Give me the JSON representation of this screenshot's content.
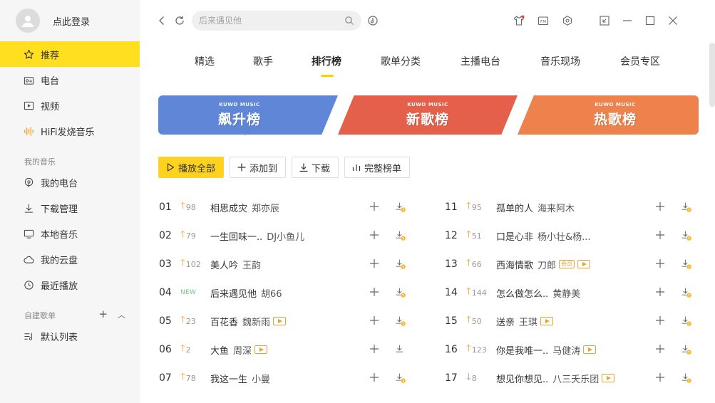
{
  "user": {
    "login_label": "点此登录"
  },
  "sidebar": {
    "nav": [
      {
        "label": "推荐",
        "icon": "star-icon"
      },
      {
        "label": "电台",
        "icon": "radio-icon"
      },
      {
        "label": "视频",
        "icon": "video-icon"
      },
      {
        "label": "HiFi发烧音乐",
        "icon": "hifi-icon"
      }
    ],
    "my_music_label": "我的音乐",
    "my_music": [
      {
        "label": "我的电台",
        "icon": "podcast-icon"
      },
      {
        "label": "下载管理",
        "icon": "download-icon"
      },
      {
        "label": "本地音乐",
        "icon": "monitor-icon"
      },
      {
        "label": "我的云盘",
        "icon": "cloud-icon"
      },
      {
        "label": "最近播放",
        "icon": "clock-icon"
      }
    ],
    "playlist_label": "自建歌单",
    "playlists": [
      {
        "label": "默认列表",
        "icon": "playlist-icon"
      }
    ]
  },
  "search": {
    "placeholder": "后来遇见他"
  },
  "tabs": [
    {
      "label": "精选"
    },
    {
      "label": "歌手"
    },
    {
      "label": "排行榜"
    },
    {
      "label": "歌单分类"
    },
    {
      "label": "主播电台"
    },
    {
      "label": "音乐现场"
    },
    {
      "label": "会员专区"
    }
  ],
  "active_tab": 2,
  "banners": [
    {
      "brand": "KUWO MUSIC",
      "title": "飙升榜",
      "color": "#5f86d7"
    },
    {
      "brand": "KUWO MUSIC",
      "title": "新歌榜",
      "color": "#e4604b"
    },
    {
      "brand": "KUWO MUSIC",
      "title": "热歌榜",
      "color": "#ee824d"
    }
  ],
  "actions": {
    "play_all": "播放全部",
    "add_to": "添加到",
    "download": "下载",
    "full_chart": "完整榜单"
  },
  "songs": [
    {
      "rank": "01",
      "trend": "up",
      "change": "98",
      "title": "相思成灾",
      "artist": "郑亦辰",
      "mv": false,
      "vip": false,
      "paid": true
    },
    {
      "rank": "02",
      "trend": "up",
      "change": "79",
      "title": "一生回味一..",
      "artist": "DJ小鱼儿",
      "mv": false,
      "vip": false,
      "paid": true
    },
    {
      "rank": "03",
      "trend": "up",
      "change": "102",
      "title": "美人吟",
      "artist": "王韵",
      "mv": false,
      "vip": false,
      "paid": true
    },
    {
      "rank": "04",
      "trend": "new",
      "change": "NEW",
      "title": "后来遇见他",
      "artist": "胡66",
      "mv": false,
      "vip": false,
      "paid": true
    },
    {
      "rank": "05",
      "trend": "up",
      "change": "23",
      "title": "百花香",
      "artist": "魏新雨",
      "mv": true,
      "vip": false,
      "paid": true
    },
    {
      "rank": "06",
      "trend": "up",
      "change": "2",
      "title": "大鱼",
      "artist": "周深",
      "mv": true,
      "vip": false,
      "paid": false
    },
    {
      "rank": "07",
      "trend": "up",
      "change": "78",
      "title": "我这一生",
      "artist": "小曼",
      "mv": false,
      "vip": false,
      "paid": true
    },
    {
      "rank": "11",
      "trend": "up",
      "change": "95",
      "title": "孤单的人",
      "artist": "海来阿木",
      "mv": false,
      "vip": false,
      "paid": true
    },
    {
      "rank": "12",
      "trend": "up",
      "change": "51",
      "title": "口是心非",
      "artist": "杨小壮&杨...",
      "mv": false,
      "vip": false,
      "paid": true
    },
    {
      "rank": "13",
      "trend": "up",
      "change": "66",
      "title": "西海情歌",
      "artist": "刀郎",
      "mv": true,
      "vip": true,
      "vip_label": "会员",
      "paid": true
    },
    {
      "rank": "14",
      "trend": "up",
      "change": "144",
      "title": "怎么做怎么..",
      "artist": "黄静美",
      "mv": false,
      "vip": false,
      "paid": true
    },
    {
      "rank": "15",
      "trend": "up",
      "change": "50",
      "title": "送亲",
      "artist": "王琪",
      "mv": true,
      "vip": false,
      "paid": true
    },
    {
      "rank": "16",
      "trend": "up",
      "change": "123",
      "title": "你是我唯一..",
      "artist": "马健涛",
      "mv": true,
      "vip": false,
      "paid": true
    },
    {
      "rank": "17",
      "trend": "down",
      "change": "8",
      "title": "想见你想见..",
      "artist": "八三夭乐团",
      "mv": true,
      "vip": false,
      "paid": true
    }
  ],
  "colors": {
    "accent": "#ffd21f",
    "up": "#f0a022",
    "new": "#7cc37f"
  }
}
